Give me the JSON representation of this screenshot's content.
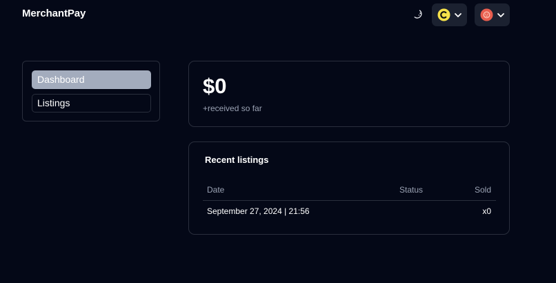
{
  "header": {
    "brand": "MerchantPay",
    "theme_toggle_icon": "moon-icon",
    "currency_selector": {
      "icon": "currency-c-icon",
      "icon_color": "#f7e24a"
    },
    "account_menu": {
      "icon": "user-avatar-icon",
      "icon_color": "#e85d4e"
    }
  },
  "sidebar": {
    "items": [
      {
        "label": "Dashboard",
        "active": true
      },
      {
        "label": "Listings",
        "active": false
      }
    ]
  },
  "stats": {
    "amount": "$0",
    "caption": "+received so far"
  },
  "recent_listings": {
    "title": "Recent listings",
    "columns": [
      "Date",
      "Status",
      "Sold"
    ],
    "rows": [
      {
        "date": "September 27, 2024 | 21:56",
        "status": "",
        "sold": "x0"
      }
    ]
  },
  "colors": {
    "background": "#040817",
    "border": "#2a2f3d",
    "active_nav": "#a3acbd",
    "muted_text": "#9aa2b3"
  }
}
